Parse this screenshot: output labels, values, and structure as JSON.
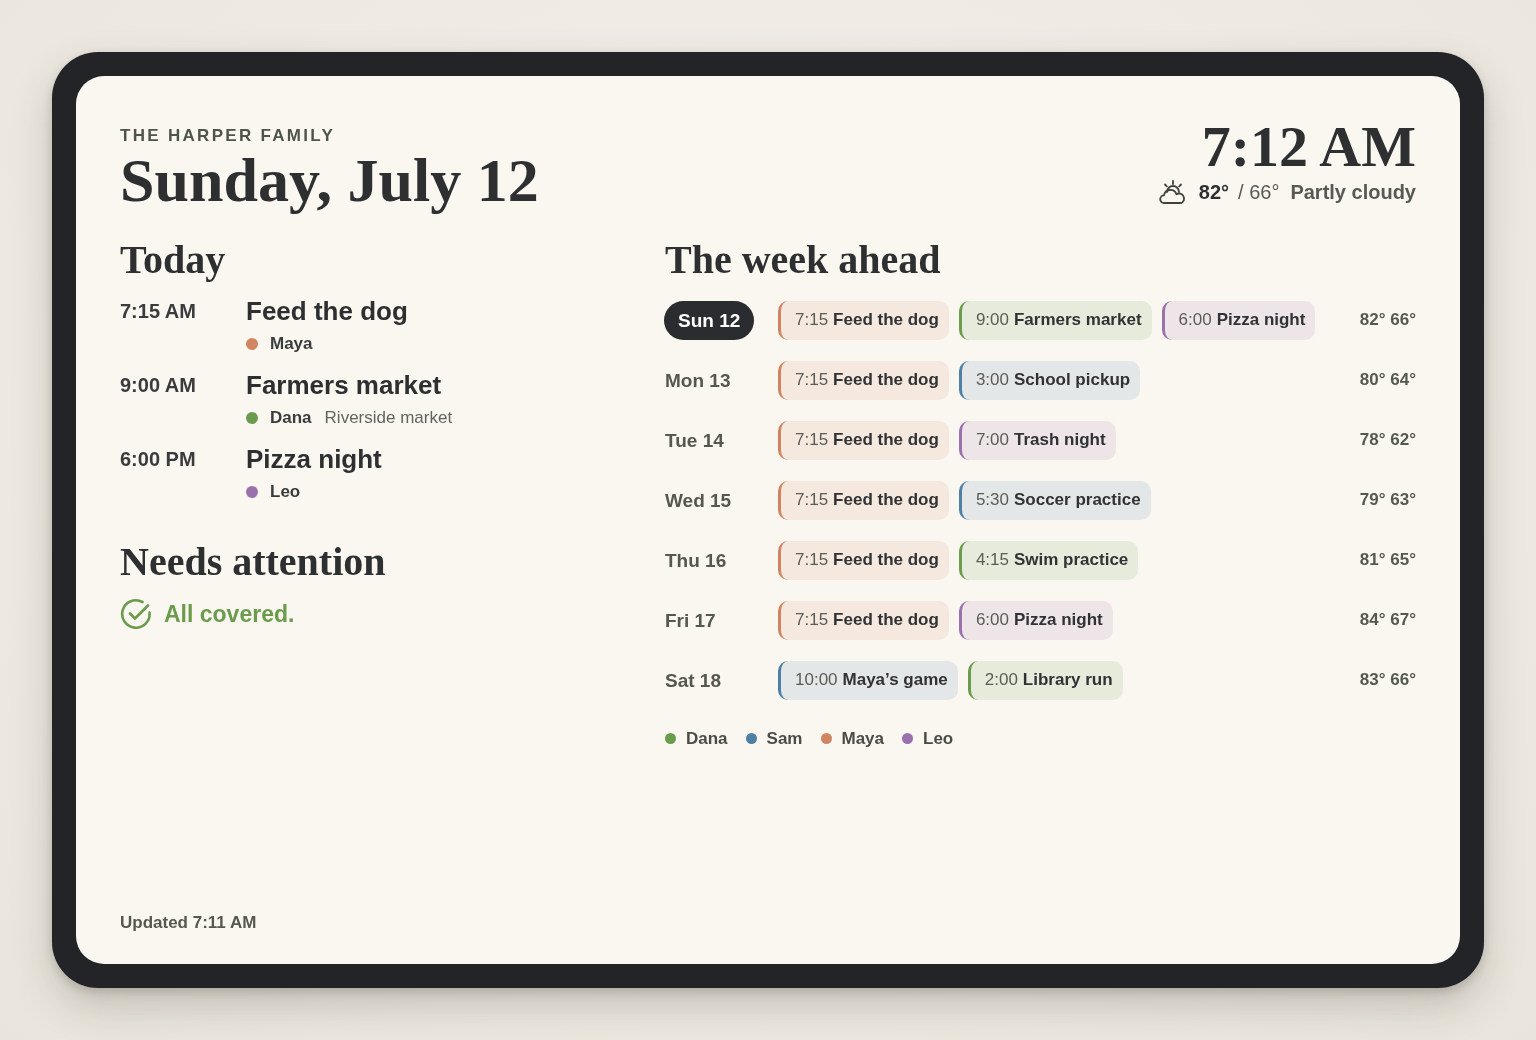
{
  "header": {
    "family": "THE HARPER FAMILY",
    "date": "Sunday, July 12",
    "time": "7:12 AM",
    "weather": {
      "high": "82°",
      "low": "/ 66°",
      "condition": "Partly cloudy"
    }
  },
  "today": {
    "title": "Today",
    "events": [
      {
        "time": "7:15 AM",
        "title": "Feed the dog",
        "person": "Maya",
        "color": "#d08462"
      },
      {
        "time": "9:00 AM",
        "title": "Farmers market",
        "person": "Dana",
        "color": "#6b9b4d",
        "location": "Riverside market"
      },
      {
        "time": "6:00 PM",
        "title": "Pizza night",
        "person": "Leo",
        "color": "#9a70ad"
      }
    ]
  },
  "attention": {
    "title": "Needs attention",
    "status": "All covered."
  },
  "week": {
    "title": "The week ahead",
    "days": [
      {
        "label": "Sun 12",
        "selected": true,
        "temps": "82° 66°",
        "events": [
          {
            "time": "7:15",
            "title": "Feed the dog",
            "color": "#d08462"
          },
          {
            "time": "9:00",
            "title": "Farmers market",
            "color": "#6b9b4d"
          },
          {
            "time": "6:00",
            "title": "Pizza night",
            "color": "#9a70ad"
          }
        ]
      },
      {
        "label": "Mon 13",
        "selected": false,
        "temps": "80° 64°",
        "events": [
          {
            "time": "7:15",
            "title": "Feed the dog",
            "color": "#d08462"
          },
          {
            "time": "3:00",
            "title": "School pickup",
            "color": "#4e7fa4"
          }
        ]
      },
      {
        "label": "Tue 14",
        "selected": false,
        "temps": "78° 62°",
        "events": [
          {
            "time": "7:15",
            "title": "Feed the dog",
            "color": "#d08462"
          },
          {
            "time": "7:00",
            "title": "Trash night",
            "color": "#9a70ad"
          }
        ]
      },
      {
        "label": "Wed 15",
        "selected": false,
        "temps": "79° 63°",
        "events": [
          {
            "time": "7:15",
            "title": "Feed the dog",
            "color": "#d08462"
          },
          {
            "time": "5:30",
            "title": "Soccer practice",
            "color": "#4e7fa4"
          }
        ]
      },
      {
        "label": "Thu 16",
        "selected": false,
        "temps": "81° 65°",
        "events": [
          {
            "time": "7:15",
            "title": "Feed the dog",
            "color": "#d08462"
          },
          {
            "time": "4:15",
            "title": "Swim practice",
            "color": "#6b9b4d"
          }
        ]
      },
      {
        "label": "Fri 17",
        "selected": false,
        "temps": "84° 67°",
        "events": [
          {
            "time": "7:15",
            "title": "Feed the dog",
            "color": "#d08462"
          },
          {
            "time": "6:00",
            "title": "Pizza night",
            "color": "#9a70ad"
          }
        ]
      },
      {
        "label": "Sat 18",
        "selected": false,
        "temps": "83° 66°",
        "events": [
          {
            "time": "10:00",
            "title": "Maya’s game",
            "color": "#4e7fa4"
          },
          {
            "time": "2:00",
            "title": "Library run",
            "color": "#6b9b4d"
          }
        ]
      }
    ],
    "legend": [
      {
        "name": "Dana",
        "color": "#6b9b4d"
      },
      {
        "name": "Sam",
        "color": "#4e7fa4"
      },
      {
        "name": "Maya",
        "color": "#d08462"
      },
      {
        "name": "Leo",
        "color": "#9a70ad"
      }
    ]
  },
  "footer": {
    "updated": "Updated 7:11 AM"
  }
}
